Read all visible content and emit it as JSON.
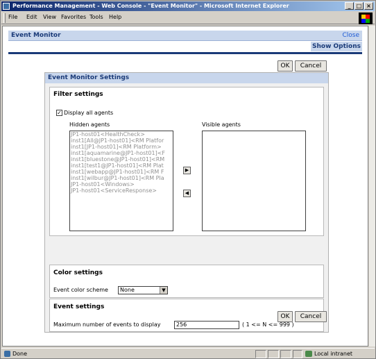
{
  "window": {
    "title": "Performance Management - Web Console - \"Event Monitor\" - Microsoft Internet Explorer"
  },
  "menu": [
    "File",
    "Edit",
    "View",
    "Favorites",
    "Tools",
    "Help"
  ],
  "page": {
    "title": "Event Monitor",
    "close_label": "Close",
    "show_options_label": "Show Options"
  },
  "buttons": {
    "ok": "OK",
    "cancel": "Cancel"
  },
  "settings": {
    "title": "Event Monitor Settings",
    "filter": {
      "title": "Filter settings",
      "display_all_label": "Display all agents",
      "display_all_checked": true,
      "hidden_label": "Hidden agents",
      "visible_label": "Visible agents",
      "hidden_agents": [
        "JP1-host01<HealthCheck>",
        "inst1[All@JP1-host01]<RM Platfor",
        "inst1[JP1-host01]<RM Platform>",
        "inst1[aquamarine@JP1-host01]<F",
        "inst1[bluestone@JP1-host01]<RM",
        "inst1[test1@JP1-host01]<RM Plat",
        "inst1[webapp@JP1-host01]<RM F",
        "inst1[wilbur@JP1-host01]<RM Pla",
        "JP1-host01<Windows>",
        "JP1-host01<ServiceResponse>"
      ],
      "visible_agents": [],
      "move_right_icon": "arrow-right-icon",
      "move_left_icon": "arrow-left-icon"
    },
    "color": {
      "title": "Color settings",
      "scheme_label": "Event color scheme",
      "scheme_value": "None"
    },
    "events": {
      "title": "Event settings",
      "max_label": "Maximum number of events to display",
      "max_value": "256",
      "range_hint": "( 1 <= N <= 999 )"
    }
  },
  "status": {
    "text": "Done",
    "zone": "Local intranet"
  }
}
